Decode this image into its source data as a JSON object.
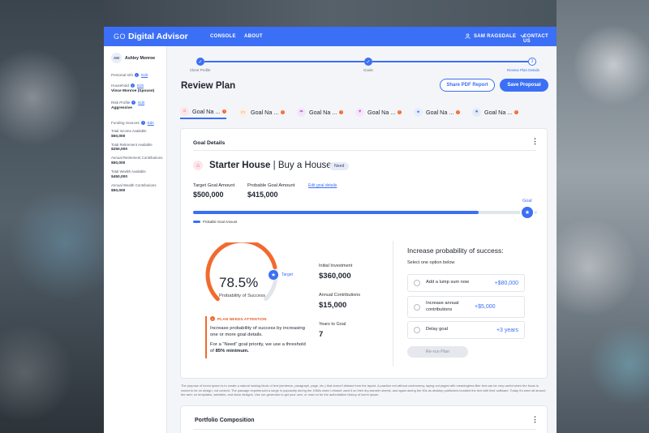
{
  "header": {
    "brand_prefix": "GO",
    "brand_name": "Digital Advisor",
    "nav": [
      "CONSOLE",
      "ABOUT"
    ],
    "user": "SAM RAGSDALE",
    "contact": "CONTACT US"
  },
  "sidebar": {
    "client_initials": "AM",
    "client_name": "Ashley Monroe",
    "personal_info_label": "Personal Info",
    "household_label": "Household",
    "household_value": "Vince Monroe (Spouse)",
    "risk_label": "Risk Profile",
    "risk_value": "Aggressive",
    "funding_label": "Funding Sources",
    "edit_label": "Edit",
    "funding": [
      {
        "label": "Total Income Available",
        "value": "$50,000"
      },
      {
        "label": "Total Retirement Available",
        "value": "$250,000"
      },
      {
        "label": "Annual Retirement Contributions",
        "value": "$50,000"
      },
      {
        "label": "Total Wealth Available",
        "value": "$450,000"
      },
      {
        "label": "Annual Wealth Contributions",
        "value": "$50,000"
      }
    ]
  },
  "stepper": {
    "steps": [
      "Client Profile",
      "Goals",
      "Review Plan Details"
    ],
    "current_number": "3",
    "done_mark": "✓"
  },
  "page": {
    "title": "Review Plan",
    "share_button": "Share PDF Report",
    "save_button": "Save Proposal"
  },
  "goal_tabs": [
    {
      "label": "Goal Na ...",
      "icon": "house-icon",
      "color": "#e2486b",
      "bg": "#fde6ea"
    },
    {
      "label": "Goal Na ...",
      "icon": "car-icon",
      "color": "#d9822b",
      "bg": "#fdf0e3"
    },
    {
      "label": "Goal Na ...",
      "icon": "umbrella-icon",
      "color": "#b05fd1",
      "bg": "#f3e6fa"
    },
    {
      "label": "Goal Na ...",
      "icon": "heart-icon",
      "color": "#c65fd1",
      "bg": "#f7e6fa"
    },
    {
      "label": "Goal Na ...",
      "icon": "graduation-icon",
      "color": "#3b6ff5",
      "bg": "#e6edfd"
    },
    {
      "label": "Goal Na ...",
      "icon": "person-icon",
      "color": "#4a73c9",
      "bg": "#e4ebf8"
    }
  ],
  "goal_details": {
    "section_title": "Goal Details",
    "goal_name": "Starter House",
    "goal_type": "Buy a House",
    "badge": "Need",
    "target_label": "Target Goal Amount",
    "target_value": "$500,000",
    "probable_label": "Probable Goal Amount",
    "probable_value": "$415,000",
    "edit_link": "Edit goal details",
    "goal_marker_label": "Goal",
    "progress_fraction": 0.83,
    "legend": "Probable Goal Amount",
    "probability": "78.5%",
    "probability_value": 78.5,
    "target_probability_value": 85,
    "probability_label": "Probability of Success",
    "target_label_short": "Target",
    "initial_investment_label": "Initial Investment",
    "initial_investment": "$360,000",
    "annual_contrib_label": "Annual Contributions",
    "annual_contrib": "$15,000",
    "years_label": "Years to Goal",
    "years": "7",
    "attention_title": "PLAN NEEDS ATTENTION",
    "attention_body": "Increase probability of success by increasing one or more goal details.",
    "attention_body2_pre": "For a “Need” goal priority, we use a threshold of",
    "attention_body2_bold": "85% minimum."
  },
  "increase": {
    "title": "Increase probability of success:",
    "subtitle": "Select one option below",
    "options": [
      {
        "label": "Add a lump sum now",
        "value": "+$80,000"
      },
      {
        "label": "Increase annual contributions",
        "value": "+$5,000"
      },
      {
        "label": "Delay goal",
        "value": "+3 years"
      }
    ],
    "rerun": "Re-run Plan"
  },
  "disclaimer": "The purpose of lorem ipsum is to create a natural looking block of text (sentence, paragraph, page, etc.) that doesn't distract from the layout. A practice not without controversy, laying out pages with meaningless filler text can be very useful when the focus is meant to be on design, not content. The passage experienced a surge in popularity during the 1960s when Letraset used it on their dry-transfer sheets, and again during the 90s as desktop publishers bundled the text with their software. Today it's seen all around the web; on templates, websites, and stock designs. Use our generator to get your own, or read on for the authoritative history of lorem ipsum.",
  "portfolio": {
    "title": "Portfolio Composition"
  },
  "colors": {
    "accent": "#3b6ff5",
    "warning": "#f26a2e"
  }
}
